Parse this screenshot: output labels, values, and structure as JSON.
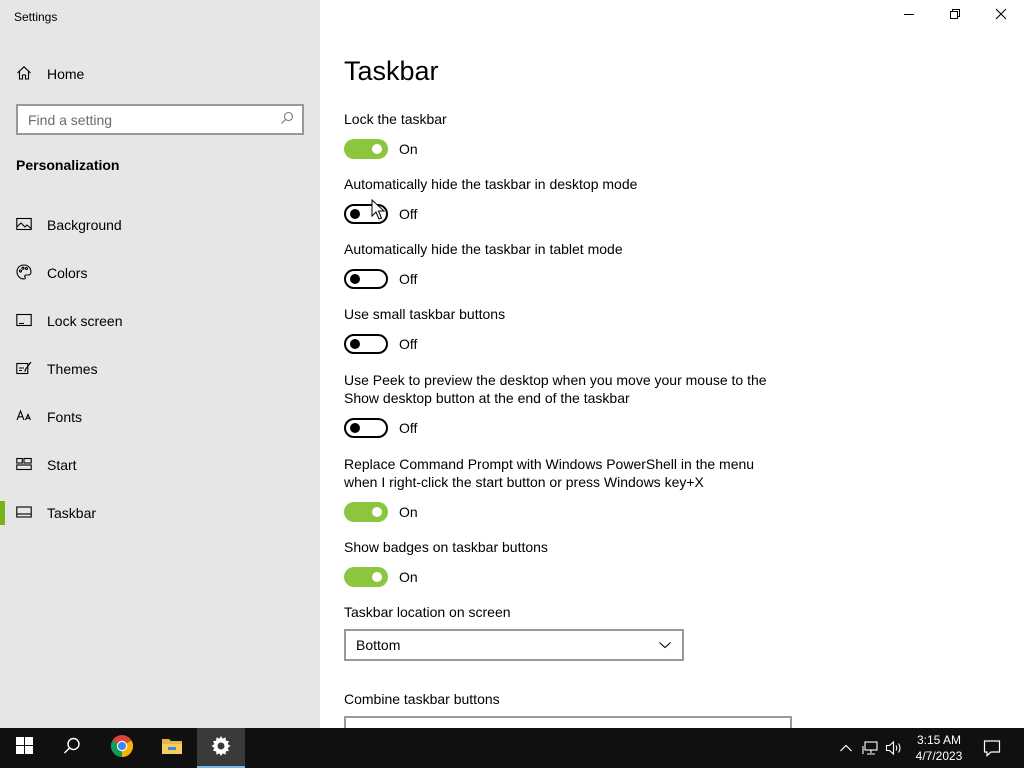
{
  "window": {
    "title": "Settings"
  },
  "sidebar": {
    "home_label": "Home",
    "search_placeholder": "Find a setting",
    "section_title": "Personalization",
    "items": [
      {
        "label": "Background",
        "icon": "picture-icon"
      },
      {
        "label": "Colors",
        "icon": "palette-icon"
      },
      {
        "label": "Lock screen",
        "icon": "lock-screen-icon"
      },
      {
        "label": "Themes",
        "icon": "themes-icon"
      },
      {
        "label": "Fonts",
        "icon": "fonts-icon"
      },
      {
        "label": "Start",
        "icon": "start-icon"
      },
      {
        "label": "Taskbar",
        "icon": "taskbar-icon",
        "selected": true
      }
    ]
  },
  "main": {
    "page_title": "Taskbar",
    "settings": [
      {
        "label": "Lock the taskbar",
        "state": "On"
      },
      {
        "label": "Automatically hide the taskbar in desktop mode",
        "state": "Off"
      },
      {
        "label": "Automatically hide the taskbar in tablet mode",
        "state": "Off"
      },
      {
        "label": "Use small taskbar buttons",
        "state": "Off"
      },
      {
        "label": "Use Peek to preview the desktop when you move your mouse to the Show desktop button at the end of the taskbar",
        "state": "Off"
      },
      {
        "label": "Replace Command Prompt with Windows PowerShell in the menu when I right-click the start button or press Windows key+X",
        "state": "On"
      },
      {
        "label": "Show badges on taskbar buttons",
        "state": "On"
      }
    ],
    "location_label": "Taskbar location on screen",
    "location_value": "Bottom",
    "combine_label": "Combine taskbar buttons"
  },
  "taskbar": {
    "time": "3:15 AM",
    "date": "4/7/2023",
    "apps": [
      "windows-start-icon",
      "search-icon",
      "chrome-icon",
      "file-explorer-icon",
      "settings-gear-icon"
    ]
  },
  "colors": {
    "accent": "#8cc63f",
    "sidebar_bg": "#e6e6e6",
    "taskbar_bg": "#101010"
  }
}
